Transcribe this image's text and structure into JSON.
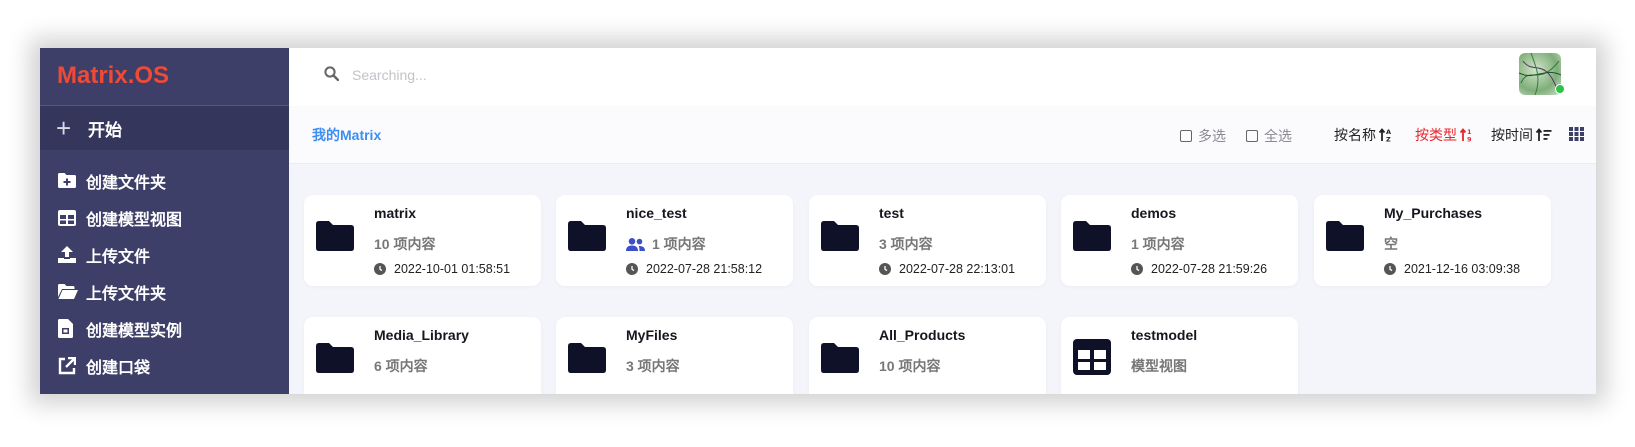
{
  "app": {
    "logo": "Matrix.OS"
  },
  "sidebar": {
    "start_label": "开始",
    "items": [
      {
        "label": "创建文件夹",
        "icon": "folder-plus-icon"
      },
      {
        "label": "创建模型视图",
        "icon": "table-icon"
      },
      {
        "label": "上传文件",
        "icon": "upload-icon"
      },
      {
        "label": "上传文件夹",
        "icon": "folder-open-icon"
      },
      {
        "label": "创建模型实例",
        "icon": "file-icon"
      },
      {
        "label": "创建口袋",
        "icon": "external-link-icon"
      }
    ]
  },
  "search": {
    "placeholder": "Searching..."
  },
  "toolbar": {
    "breadcrumb": "我的Matrix",
    "multi_select": "多选",
    "select_all": "全选",
    "sort_name": "按名称",
    "sort_type": "按类型",
    "sort_time": "按时间",
    "active_sort_color": "#e8252b"
  },
  "items": [
    {
      "name": "matrix",
      "count": "10 项内容",
      "date": "2022-10-01 01:58:51",
      "icon": "folder-icon"
    },
    {
      "name": "nice_test",
      "count": "1 项内容",
      "date": "2022-07-28 21:58:12",
      "icon": "folder-icon",
      "shared": true
    },
    {
      "name": "test",
      "count": "3 项内容",
      "date": "2022-07-28 22:13:01",
      "icon": "folder-icon"
    },
    {
      "name": "demos",
      "count": "1 项内容",
      "date": "2022-07-28 21:59:26",
      "icon": "folder-icon"
    },
    {
      "name": "My_Purchases",
      "count": "空",
      "date": "2021-12-16 03:09:38",
      "icon": "folder-icon"
    },
    {
      "name": "Media_Library",
      "count": "6 项内容",
      "icon": "folder-icon"
    },
    {
      "name": "MyFiles",
      "count": "3 项内容",
      "icon": "folder-icon"
    },
    {
      "name": "All_Products",
      "count": "10 项内容",
      "icon": "folder-icon"
    },
    {
      "name": "testmodel",
      "count": "模型视图",
      "icon": "table-icon"
    }
  ]
}
